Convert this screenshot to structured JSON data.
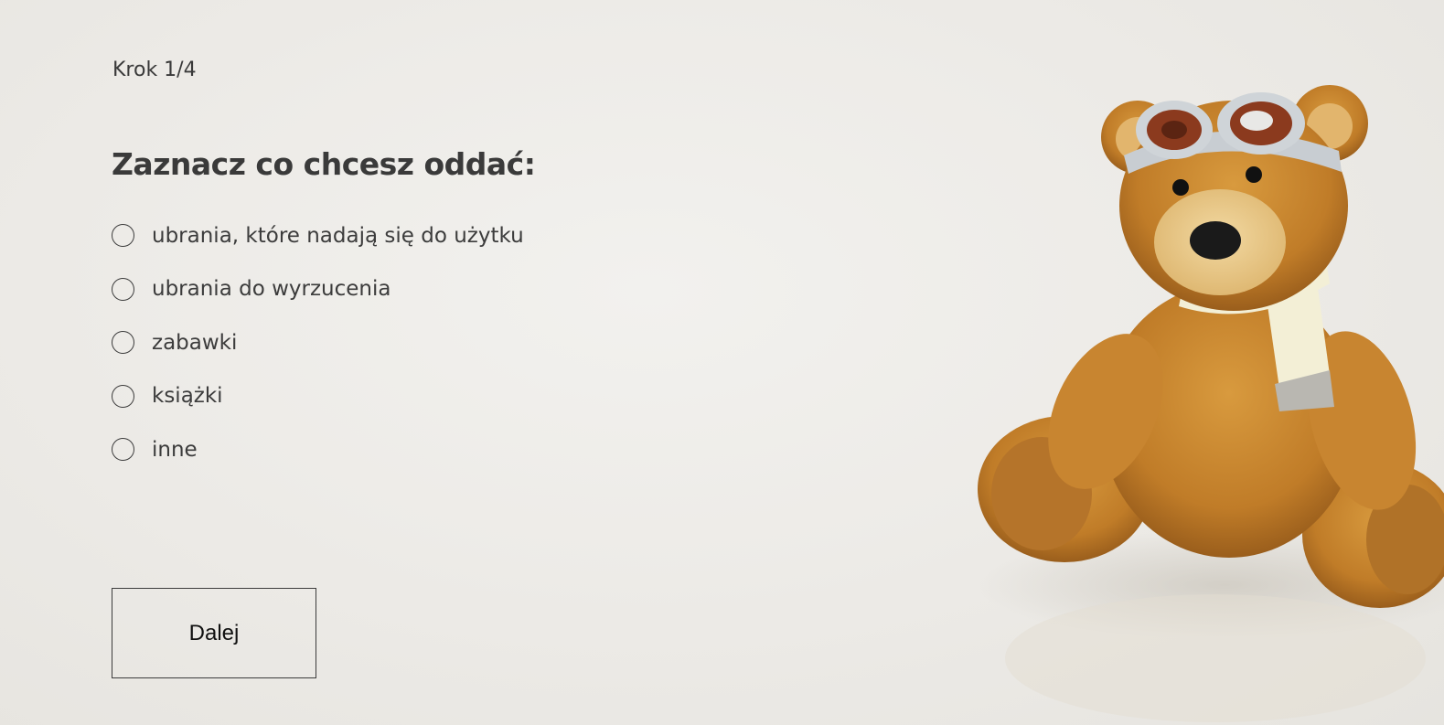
{
  "form": {
    "step": "Krok 1/4",
    "title": "Zaznacz co chcesz oddać:",
    "options": [
      {
        "label": "ubrania, które nadają się do użytku",
        "checked": false
      },
      {
        "label": "ubrania do wyrzucenia",
        "checked": false
      },
      {
        "label": "zabawki",
        "checked": false
      },
      {
        "label": "książki",
        "checked": false
      },
      {
        "label": "inne",
        "checked": false
      }
    ],
    "next_label": "Dalej"
  },
  "image": {
    "subject": "teddy-bear-with-goggles-and-scarf"
  },
  "colors": {
    "background": "#eceae6",
    "text": "#3c3c3c",
    "bear_fur": "#c8882e",
    "bear_muzzle": "#e9c98b",
    "scarf": "#f3efd6",
    "goggles_lens": "#8b3a1e"
  }
}
